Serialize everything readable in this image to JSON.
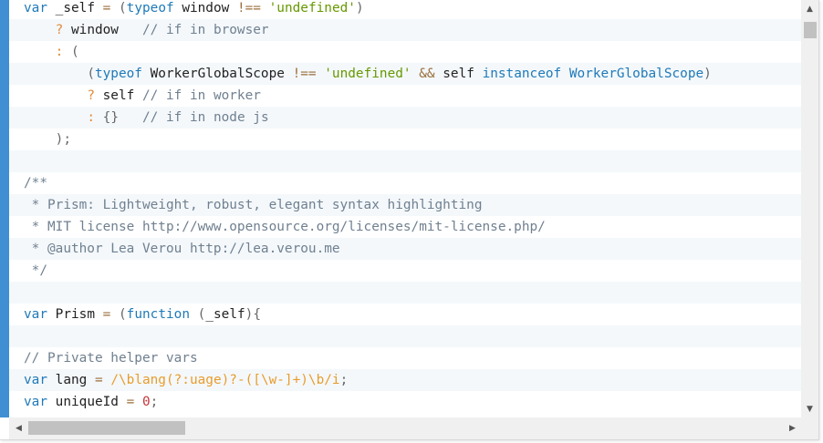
{
  "code": {
    "lines": [
      {
        "tokens": [
          {
            "t": "var",
            "c": "keyword"
          },
          {
            "t": " _self ",
            "c": "plain"
          },
          {
            "t": "=",
            "c": "operator"
          },
          {
            "t": " ",
            "c": "plain"
          },
          {
            "t": "(",
            "c": "punct"
          },
          {
            "t": "typeof",
            "c": "keyword"
          },
          {
            "t": " window ",
            "c": "plain"
          },
          {
            "t": "!==",
            "c": "operator"
          },
          {
            "t": " ",
            "c": "plain"
          },
          {
            "t": "'undefined'",
            "c": "string"
          },
          {
            "t": ")",
            "c": "punct"
          }
        ]
      },
      {
        "tokens": [
          {
            "t": "    ",
            "c": "plain"
          },
          {
            "t": "?",
            "c": "ternary"
          },
          {
            "t": " window   ",
            "c": "plain"
          },
          {
            "t": "// if in browser",
            "c": "comment"
          }
        ]
      },
      {
        "tokens": [
          {
            "t": "    ",
            "c": "plain"
          },
          {
            "t": ":",
            "c": "ternary"
          },
          {
            "t": " ",
            "c": "plain"
          },
          {
            "t": "(",
            "c": "punct"
          }
        ]
      },
      {
        "tokens": [
          {
            "t": "        ",
            "c": "plain"
          },
          {
            "t": "(",
            "c": "punct"
          },
          {
            "t": "typeof",
            "c": "keyword"
          },
          {
            "t": " WorkerGlobalScope ",
            "c": "plain"
          },
          {
            "t": "!==",
            "c": "operator"
          },
          {
            "t": " ",
            "c": "plain"
          },
          {
            "t": "'undefined'",
            "c": "string"
          },
          {
            "t": " ",
            "c": "plain"
          },
          {
            "t": "&&",
            "c": "operator"
          },
          {
            "t": " self ",
            "c": "plain"
          },
          {
            "t": "instanceof",
            "c": "keyword"
          },
          {
            "t": " ",
            "c": "plain"
          },
          {
            "t": "WorkerGlobalScope",
            "c": "class"
          },
          {
            "t": ")",
            "c": "punct"
          }
        ]
      },
      {
        "tokens": [
          {
            "t": "        ",
            "c": "plain"
          },
          {
            "t": "?",
            "c": "ternary"
          },
          {
            "t": " self ",
            "c": "plain"
          },
          {
            "t": "// if in worker",
            "c": "comment"
          }
        ]
      },
      {
        "tokens": [
          {
            "t": "        ",
            "c": "plain"
          },
          {
            "t": ":",
            "c": "ternary"
          },
          {
            "t": " ",
            "c": "plain"
          },
          {
            "t": "{}",
            "c": "punct"
          },
          {
            "t": "   ",
            "c": "plain"
          },
          {
            "t": "// if in node js",
            "c": "comment"
          }
        ]
      },
      {
        "tokens": [
          {
            "t": "    ",
            "c": "plain"
          },
          {
            "t": ");",
            "c": "punct"
          }
        ]
      },
      {
        "tokens": []
      },
      {
        "tokens": [
          {
            "t": "/**",
            "c": "comment"
          }
        ]
      },
      {
        "tokens": [
          {
            "t": " * Prism: Lightweight, robust, elegant syntax highlighting",
            "c": "comment"
          }
        ]
      },
      {
        "tokens": [
          {
            "t": " * MIT license http://www.opensource.org/licenses/mit-license.php/",
            "c": "comment"
          }
        ]
      },
      {
        "tokens": [
          {
            "t": " * @author Lea Verou http://lea.verou.me",
            "c": "comment"
          }
        ]
      },
      {
        "tokens": [
          {
            "t": " */",
            "c": "comment"
          }
        ]
      },
      {
        "tokens": []
      },
      {
        "tokens": [
          {
            "t": "var",
            "c": "keyword"
          },
          {
            "t": " Prism ",
            "c": "plain"
          },
          {
            "t": "=",
            "c": "operator"
          },
          {
            "t": " ",
            "c": "plain"
          },
          {
            "t": "(",
            "c": "punct"
          },
          {
            "t": "function",
            "c": "keyword"
          },
          {
            "t": " ",
            "c": "plain"
          },
          {
            "t": "(",
            "c": "punct"
          },
          {
            "t": "_self",
            "c": "plain"
          },
          {
            "t": "){",
            "c": "punct"
          }
        ]
      },
      {
        "tokens": []
      },
      {
        "tokens": [
          {
            "t": "// Private helper vars",
            "c": "comment"
          }
        ]
      },
      {
        "tokens": [
          {
            "t": "var",
            "c": "keyword"
          },
          {
            "t": " lang ",
            "c": "plain"
          },
          {
            "t": "=",
            "c": "operator"
          },
          {
            "t": " ",
            "c": "plain"
          },
          {
            "t": "/\\blang(?:uage)?-([\\w-]+)\\b/i",
            "c": "regex"
          },
          {
            "t": ";",
            "c": "punct"
          }
        ]
      },
      {
        "tokens": [
          {
            "t": "var",
            "c": "keyword"
          },
          {
            "t": " uniqueId ",
            "c": "plain"
          },
          {
            "t": "=",
            "c": "operator"
          },
          {
            "t": " ",
            "c": "plain"
          },
          {
            "t": "0",
            "c": "number"
          },
          {
            "t": ";",
            "c": "punct"
          }
        ]
      }
    ]
  },
  "scrollbars": {
    "vertical": {
      "up_icon": "▲",
      "down_icon": "▼",
      "position_fraction": 0.0
    },
    "horizontal": {
      "left_icon": "◀",
      "right_icon": "▶",
      "position_fraction": 0.0
    }
  },
  "colors": {
    "gutter_accent": "#3f8fd2",
    "keyword": "#1f7ab8",
    "string": "#669900",
    "comment": "#708090",
    "regex": "#e99c2c",
    "number": "#c4353a",
    "operator": "#9a6e3a",
    "ternary": "#e08b3a",
    "stripe": "#f4f8fb"
  }
}
